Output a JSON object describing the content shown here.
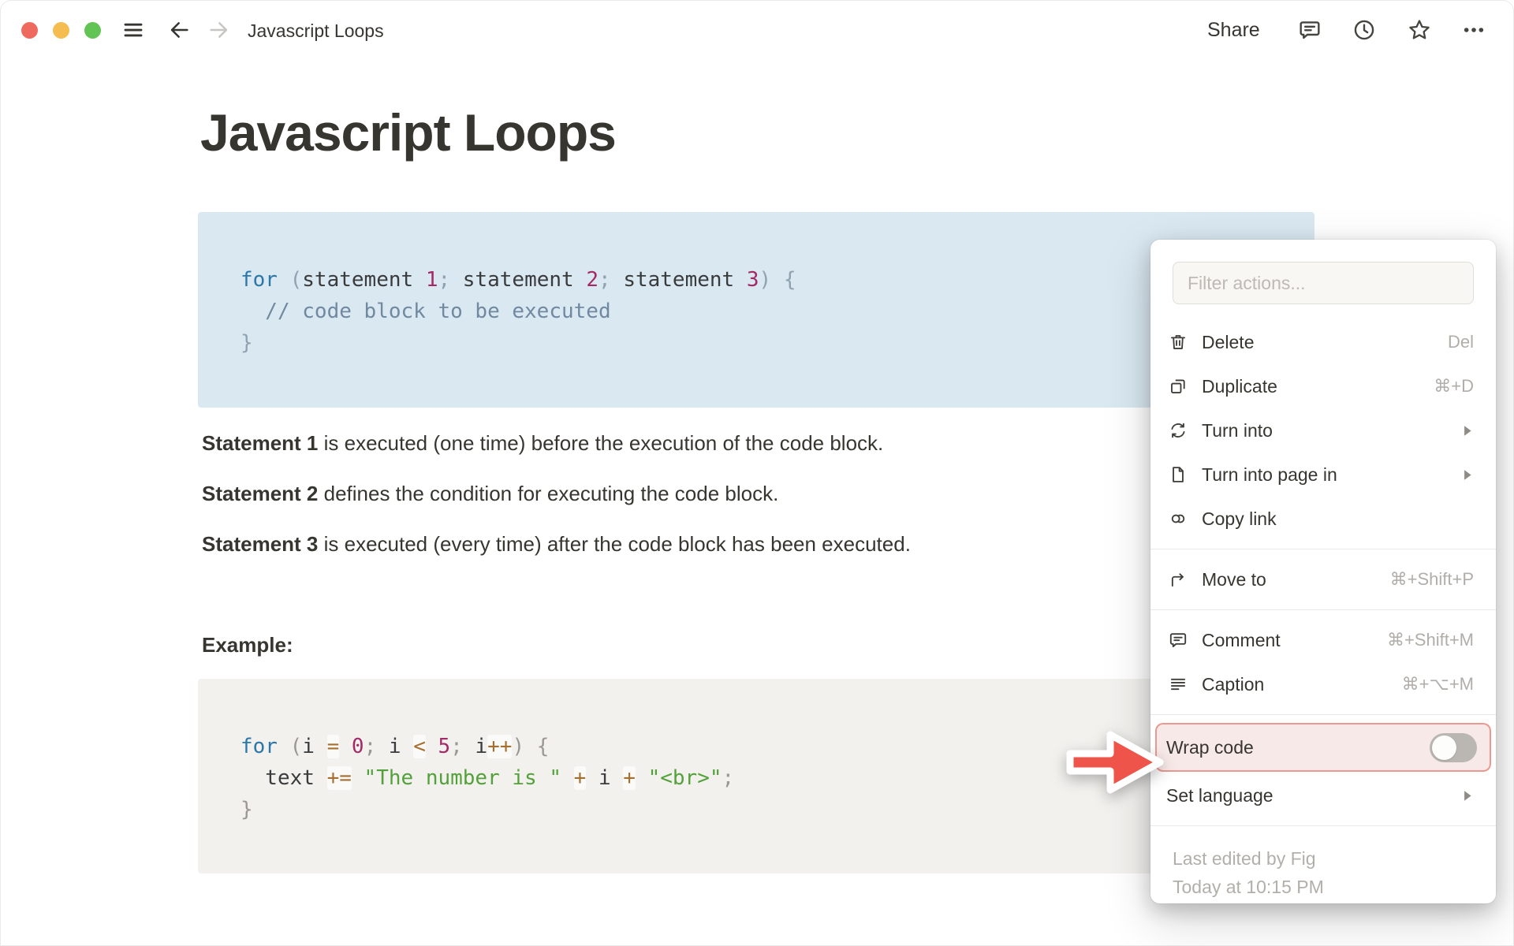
{
  "topbar": {
    "doc_title": "Javascript Loops",
    "share_label": "Share"
  },
  "doc": {
    "title": "Javascript Loops",
    "paragraphs": [
      {
        "bold": "Statement 1",
        "rest": " is executed (one time) before the execution of the code block."
      },
      {
        "bold": "Statement 2",
        "rest": " defines the condition for executing the code block."
      },
      {
        "bold": "Statement 3",
        "rest": " is executed (every time) after the code block has been executed."
      }
    ],
    "example_label": "Example:",
    "code_block_1": {
      "language": "javascript",
      "lines": [
        [
          [
            "kw",
            "for"
          ],
          [
            "pl",
            " "
          ],
          [
            "pun",
            "("
          ],
          [
            "pl",
            "statement "
          ],
          [
            "num",
            "1"
          ],
          [
            "pun",
            "; "
          ],
          [
            "pl",
            "statement "
          ],
          [
            "num",
            "2"
          ],
          [
            "pun",
            "; "
          ],
          [
            "pl",
            "statement "
          ],
          [
            "num",
            "3"
          ],
          [
            "pun",
            ") {"
          ]
        ],
        [
          [
            "com",
            "  // code block to be executed"
          ]
        ],
        [
          [
            "pun",
            "}"
          ]
        ]
      ]
    },
    "code_block_2": {
      "language": "javascript",
      "lines": [
        [
          [
            "kw",
            "for"
          ],
          [
            "pl",
            " "
          ],
          [
            "pun",
            "("
          ],
          [
            "pl",
            "i "
          ],
          [
            "op",
            "="
          ],
          [
            "pl",
            " "
          ],
          [
            "num",
            "0"
          ],
          [
            "pun",
            "; "
          ],
          [
            "pl",
            "i "
          ],
          [
            "op",
            "<"
          ],
          [
            "pl",
            " "
          ],
          [
            "num",
            "5"
          ],
          [
            "pun",
            "; "
          ],
          [
            "pl",
            "i"
          ],
          [
            "op",
            "++"
          ],
          [
            "pun",
            ") {"
          ]
        ],
        [
          [
            "pl",
            "  text "
          ],
          [
            "op",
            "+="
          ],
          [
            "pl",
            " "
          ],
          [
            "str",
            "\"The number is \""
          ],
          [
            "pl",
            " "
          ],
          [
            "op",
            "+"
          ],
          [
            "pl",
            " i "
          ],
          [
            "op",
            "+"
          ],
          [
            "pl",
            " "
          ],
          [
            "str",
            "\"<br>\""
          ],
          [
            "pun",
            ";"
          ]
        ],
        [
          [
            "pun",
            "}"
          ]
        ]
      ]
    }
  },
  "menu": {
    "filter_placeholder": "Filter actions...",
    "sections": [
      {
        "items": [
          {
            "icon": "trash",
            "label": "Delete",
            "shortcut": "Del"
          },
          {
            "icon": "duplicate",
            "label": "Duplicate",
            "shortcut": "⌘+D"
          },
          {
            "icon": "turn-into",
            "label": "Turn into",
            "submenu": true
          },
          {
            "icon": "page",
            "label": "Turn into page in",
            "submenu": true
          },
          {
            "icon": "copy-link",
            "label": "Copy link"
          }
        ]
      },
      {
        "items": [
          {
            "icon": "move-to",
            "label": "Move to",
            "shortcut": "⌘+Shift+P"
          }
        ]
      },
      {
        "items": [
          {
            "icon": "comment",
            "label": "Comment",
            "shortcut": "⌘+Shift+M"
          },
          {
            "icon": "caption",
            "label": "Caption",
            "shortcut": "⌘+⌥+M"
          }
        ]
      },
      {
        "items": [
          {
            "label": "Wrap code",
            "toggle": "off",
            "highlighted": true
          },
          {
            "label": "Set language",
            "submenu": true
          }
        ]
      }
    ],
    "footer": {
      "line1": "Last edited by Fig",
      "line2": "Today at 10:15 PM"
    }
  },
  "colors": {
    "text": "#37352f",
    "code_block_1_bg": "#d9e8f1",
    "code_block_2_bg": "#f2f1ee",
    "highlight_row_bg": "#f7e9e7",
    "highlight_row_border": "#de584a",
    "arrow_red": "#ee5449",
    "traffic_red": "#ee6a5f",
    "traffic_yellow": "#f5bd4f",
    "traffic_green": "#62c454"
  }
}
